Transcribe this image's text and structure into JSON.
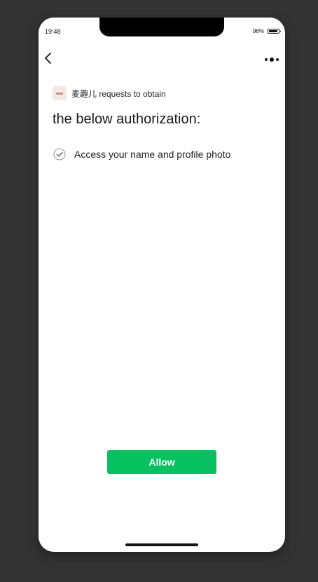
{
  "status_bar": {
    "time": "19:48",
    "battery_percent": "96%",
    "battery_level": 0.96
  },
  "nav": {
    "back_icon": "chevron-left-icon",
    "more_icon": "more-dots-icon"
  },
  "auth": {
    "app_name_line": "麦趣儿 requests to obtain",
    "title": "the below authorization:",
    "permissions": [
      {
        "label": "Access your name and profile photo",
        "checked": true
      }
    ],
    "allow_label": "Allow"
  },
  "colors": {
    "background": "#333333",
    "accent": "#07c160",
    "text": "#1a1a1a"
  }
}
